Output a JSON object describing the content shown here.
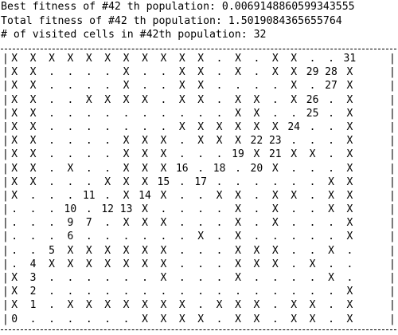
{
  "header": {
    "best_fitness": "Best fitness of #42 th population: 0.0069148860599343555",
    "total_fitness": "Total fitness of #42 th population: 1.5019084365655764",
    "visited_cells": "# of visited cells in #42th population: 32"
  },
  "grid": {
    "border_char": "|",
    "rows": [
      [
        "X",
        "X",
        "X",
        "X",
        "X",
        "X",
        "X",
        "X",
        "X",
        "X",
        "X",
        ".",
        "X",
        ".",
        "X",
        "X",
        ".",
        ".",
        "31"
      ],
      [
        "X",
        "X",
        ".",
        ".",
        ".",
        ".",
        "X",
        ".",
        ".",
        "X",
        "X",
        ".",
        "X",
        ".",
        "X",
        "X",
        "29",
        "28",
        "X"
      ],
      [
        "X",
        "X",
        ".",
        ".",
        ".",
        ".",
        "X",
        ".",
        ".",
        "X",
        "X",
        ".",
        ".",
        ".",
        ".",
        "X",
        ".",
        "27",
        "X"
      ],
      [
        "X",
        "X",
        ".",
        ".",
        "X",
        "X",
        "X",
        "X",
        ".",
        "X",
        "X",
        ".",
        "X",
        "X",
        ".",
        "X",
        "26",
        ".",
        "X"
      ],
      [
        "X",
        "X",
        ".",
        ".",
        ".",
        ".",
        ".",
        ".",
        ".",
        ".",
        ".",
        ".",
        "X",
        "X",
        ".",
        ".",
        "25",
        ".",
        "X"
      ],
      [
        "X",
        "X",
        ".",
        ".",
        ".",
        ".",
        ".",
        ".",
        ".",
        "X",
        "X",
        "X",
        "X",
        "X",
        "X",
        "24",
        ".",
        ".",
        "X"
      ],
      [
        "X",
        "X",
        ".",
        ".",
        ".",
        ".",
        "X",
        "X",
        "X",
        ".",
        "X",
        "X",
        "X",
        "22",
        "23",
        ".",
        ".",
        ".",
        "X"
      ],
      [
        "X",
        "X",
        ".",
        ".",
        ".",
        ".",
        "X",
        "X",
        "X",
        ".",
        ".",
        ".",
        "19",
        "X",
        "21",
        "X",
        "X",
        ".",
        "X"
      ],
      [
        "X",
        "X",
        ".",
        "X",
        ".",
        ".",
        "X",
        "X",
        "X",
        "16",
        ".",
        "18",
        ".",
        "20",
        "X",
        ".",
        ".",
        ".",
        "X"
      ],
      [
        "X",
        "X",
        ".",
        ".",
        ".",
        "X",
        "X",
        "X",
        "15",
        ".",
        "17",
        ".",
        ".",
        ".",
        ".",
        ".",
        ".",
        "X",
        "X"
      ],
      [
        "X",
        ".",
        ".",
        ".",
        "11",
        ".",
        "X",
        "14",
        "X",
        ".",
        ".",
        "X",
        "X",
        ".",
        "X",
        "X",
        ".",
        "X",
        "X"
      ],
      [
        ".",
        ".",
        ".",
        "10",
        ".",
        "12",
        "13",
        "X",
        ".",
        ".",
        ".",
        ".",
        "X",
        ".",
        "X",
        ".",
        ".",
        "X",
        "X"
      ],
      [
        ".",
        ".",
        ".",
        "9",
        "7",
        ".",
        "X",
        "X",
        "X",
        ".",
        ".",
        ".",
        "X",
        ".",
        "X",
        ".",
        ".",
        ".",
        "X"
      ],
      [
        ".",
        ".",
        ".",
        "6",
        ".",
        ".",
        ".",
        ".",
        ".",
        ".",
        "X",
        ".",
        "X",
        ".",
        ".",
        ".",
        ".",
        ".",
        "X"
      ],
      [
        ".",
        ".",
        "5",
        "X",
        "X",
        "X",
        "X",
        "X",
        "X",
        ".",
        ".",
        ".",
        "X",
        "X",
        "X",
        ".",
        ".",
        "X",
        "."
      ],
      [
        ".",
        "4",
        "X",
        "X",
        "X",
        "X",
        "X",
        "X",
        "X",
        ".",
        ".",
        ".",
        "X",
        "X",
        "X",
        ".",
        "X",
        ".",
        "."
      ],
      [
        "X",
        "3",
        ".",
        ".",
        ".",
        ".",
        ".",
        ".",
        "X",
        ".",
        ".",
        ".",
        "X",
        ".",
        ".",
        ".",
        ".",
        "X",
        "."
      ],
      [
        "X",
        "2",
        ".",
        ".",
        ".",
        ".",
        ".",
        ".",
        ".",
        ".",
        ".",
        ".",
        ".",
        ".",
        ".",
        ".",
        ".",
        ".",
        "X"
      ],
      [
        "X",
        "1",
        ".",
        "X",
        "X",
        "X",
        "X",
        "X",
        "X",
        "X",
        ".",
        "X",
        "X",
        "X",
        ".",
        "X",
        "X",
        ".",
        "X"
      ],
      [
        "0",
        ".",
        ".",
        ".",
        ".",
        ".",
        ".",
        "X",
        "X",
        "X",
        "X",
        ".",
        "X",
        "X",
        ".",
        "X",
        "X",
        ".",
        "X"
      ]
    ]
  }
}
